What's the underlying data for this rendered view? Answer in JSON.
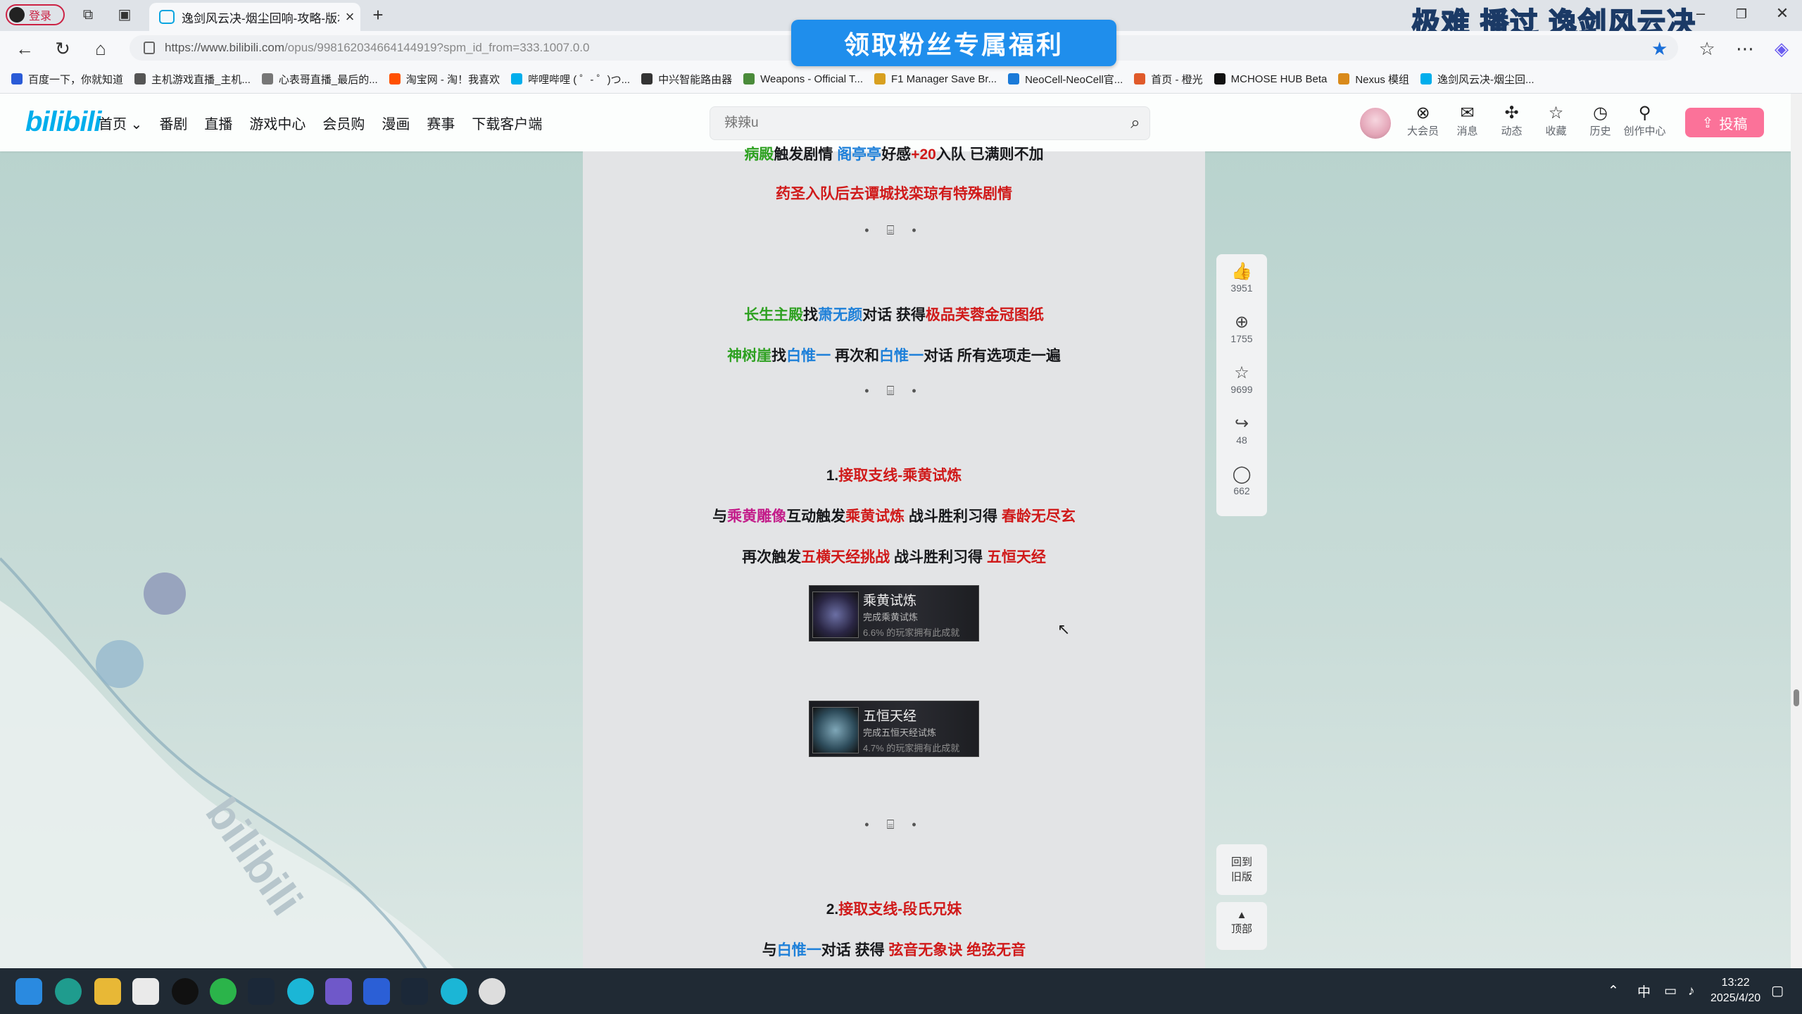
{
  "browser": {
    "login_label": "登录",
    "tab_title": "逸剑风云决-烟尘回响-攻略-版本V",
    "tab_close": "×",
    "new_tab": "+",
    "url_main": "https://www.bilibili.com",
    "url_rest": "/opus/998162034664144919?spm_id_from=333.1007.0.0",
    "promo_overlay": "极难  播过  逸剑风云决",
    "bookmarks": [
      {
        "label": "百度一下，你就知道",
        "color": "#2a5bd7"
      },
      {
        "label": "主机游戏直播_主机...",
        "color": "#555"
      },
      {
        "label": "心表哥直播_最后的...",
        "color": "#777"
      },
      {
        "label": "淘宝网 - 淘！我喜欢",
        "color": "#ff5000"
      },
      {
        "label": "哔哩哔哩 ( ゜- ゜)つ...",
        "color": "#00aeec"
      },
      {
        "label": "中兴智能路由器",
        "color": "#333"
      },
      {
        "label": "Weapons - Official T...",
        "color": "#4a8b3a"
      },
      {
        "label": "F1 Manager Save Br...",
        "color": "#d8a020"
      },
      {
        "label": "NeoCell-NeoCell官...",
        "color": "#1a7ad8"
      },
      {
        "label": "首页 - 橙光",
        "color": "#e05a2a"
      },
      {
        "label": "MCHOSE HUB Beta",
        "color": "#111"
      },
      {
        "label": "Nexus 模组",
        "color": "#d98a1a"
      },
      {
        "label": "逸剑风云决-烟尘回...",
        "color": "#00aeec"
      }
    ]
  },
  "banner": {
    "label": "领取粉丝专属福利"
  },
  "header": {
    "logo": "bilibili",
    "nav": [
      "首页 ⌄",
      "番剧",
      "直播",
      "游戏中心",
      "会员购",
      "漫画",
      "赛事",
      "下载客户端"
    ],
    "search_placeholder": "辣辣u",
    "icons": [
      {
        "label": "大会员",
        "glyph": "⊗"
      },
      {
        "label": "消息",
        "glyph": "✉"
      },
      {
        "label": "动态",
        "glyph": "✣"
      },
      {
        "label": "收藏",
        "glyph": "☆"
      },
      {
        "label": "历史",
        "glyph": "◷"
      },
      {
        "label": "创作中心",
        "glyph": "⚲"
      }
    ],
    "upload": "投稿"
  },
  "article": {
    "top_partial": [
      {
        "t": "病殿",
        "c": "green"
      },
      {
        "t": "触发剧情 ",
        "c": "dark"
      },
      {
        "t": "阁亭亭",
        "c": "blue"
      },
      {
        "t": "好感",
        "c": "dark"
      },
      {
        "t": "+20",
        "c": "red"
      },
      {
        "t": "入队 已满则不加",
        "c": "dark"
      }
    ],
    "line1": "药圣入队后去谭城找栾琼有特殊剧情",
    "line2": [
      {
        "t": "长生主殿",
        "c": "green"
      },
      {
        "t": "找",
        "c": "dark"
      },
      {
        "t": "萧无颜",
        "c": "blue"
      },
      {
        "t": "对话 获得",
        "c": "dark"
      },
      {
        "t": "极品芙蓉金冠图纸",
        "c": "red"
      }
    ],
    "line3": [
      {
        "t": "神树崖",
        "c": "green"
      },
      {
        "t": "找",
        "c": "dark"
      },
      {
        "t": "白惟一",
        "c": "blue"
      },
      {
        "t": " 再次和",
        "c": "dark"
      },
      {
        "t": "白惟一",
        "c": "blue"
      },
      {
        "t": "对话 所有选项走一遍",
        "c": "dark"
      }
    ],
    "sec1": [
      {
        "t": "1.",
        "c": "dark"
      },
      {
        "t": "接取支线-乘黄试炼",
        "c": "red"
      }
    ],
    "line4": [
      {
        "t": "与",
        "c": "dark"
      },
      {
        "t": "乘黄雕像",
        "c": "mag"
      },
      {
        "t": "互动触发",
        "c": "dark"
      },
      {
        "t": "乘黄试炼",
        "c": "red"
      },
      {
        "t": " 战斗胜利习得 ",
        "c": "dark"
      },
      {
        "t": "春龄无尽玄",
        "c": "red"
      }
    ],
    "line5": [
      {
        "t": "再次触发",
        "c": "dark"
      },
      {
        "t": "五横天经挑战",
        "c": "red"
      },
      {
        "t": " 战斗胜利习得 ",
        "c": "dark"
      },
      {
        "t": "五恒天经",
        "c": "red"
      }
    ],
    "achv1": {
      "title": "乘黄试炼",
      "desc": "完成乘黄试炼",
      "pct": "6.6% 的玩家拥有此成就"
    },
    "achv2": {
      "title": "五恒天经",
      "desc": "完成五恒天经试炼",
      "pct": "4.7% 的玩家拥有此成就"
    },
    "sec2": [
      {
        "t": "2.",
        "c": "dark"
      },
      {
        "t": "接取支线-段氏兄妹",
        "c": "red"
      }
    ],
    "line6": [
      {
        "t": "与",
        "c": "dark"
      },
      {
        "t": "白惟一",
        "c": "blue"
      },
      {
        "t": "对话 获得 ",
        "c": "dark"
      },
      {
        "t": "弦音无象诀 绝弦无音",
        "c": "red"
      }
    ],
    "separator": "• ⌸ •"
  },
  "sidebar": {
    "items": [
      {
        "glyph": "👍",
        "count": "3951"
      },
      {
        "glyph": "⊕",
        "count": "1755"
      },
      {
        "glyph": "☆",
        "count": "9699"
      },
      {
        "glyph": "↪",
        "count": "48"
      },
      {
        "glyph": "◯",
        "count": "662"
      }
    ],
    "old_version": "回到\n旧版",
    "top": "顶部"
  },
  "taskbar": {
    "time": "13:22",
    "date": "2025/4/20",
    "ime": "中"
  }
}
